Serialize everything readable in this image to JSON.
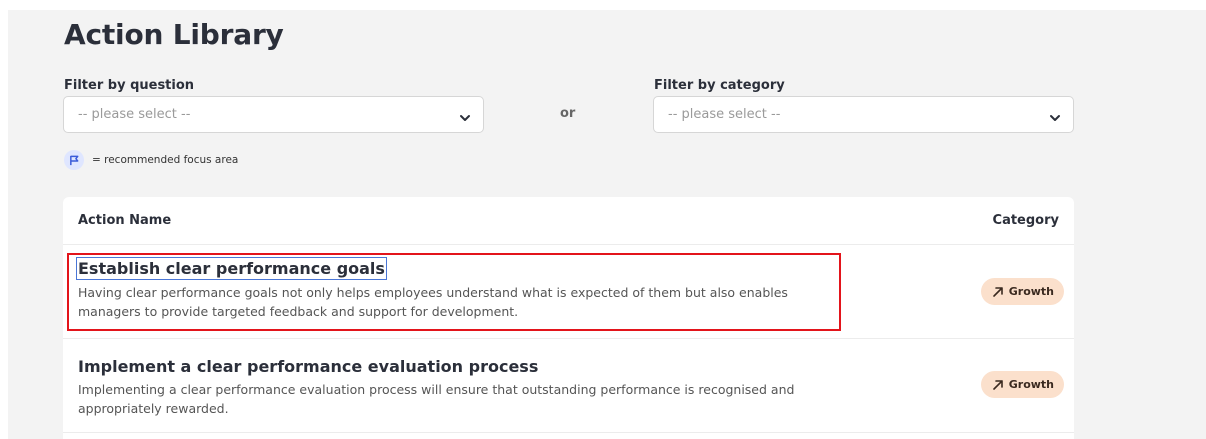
{
  "page": {
    "title": "Action Library"
  },
  "filters": {
    "question_label": "Filter by question",
    "question_placeholder": "-- please select --",
    "or_text": "or",
    "category_label": "Filter by category",
    "category_placeholder": "-- please select --"
  },
  "legend": {
    "icon": "flag-icon",
    "text": "= recommended focus area"
  },
  "table": {
    "columns": [
      "Action Name",
      "Category"
    ],
    "rows": [
      {
        "title": "Establish clear performance goals",
        "description": "Having clear performance goals not only helps employees understand what is expected of them but also enables managers to provide targeted feedback and support for development.",
        "category": "Growth",
        "category_icon": "arrow-up-right-icon"
      },
      {
        "title": "Implement a clear performance evaluation process",
        "description": "Implementing a clear performance evaluation process will ensure that outstanding performance is recognised and appropriately rewarded.",
        "category": "Growth",
        "category_icon": "arrow-up-right-icon"
      }
    ]
  },
  "colors": {
    "highlight": "#e3141b",
    "badge_bg": "#fbe0cc",
    "flag_bg": "#dfe6ff",
    "flag": "#3a5bd9",
    "panel_bg": "#f3f3f3"
  }
}
